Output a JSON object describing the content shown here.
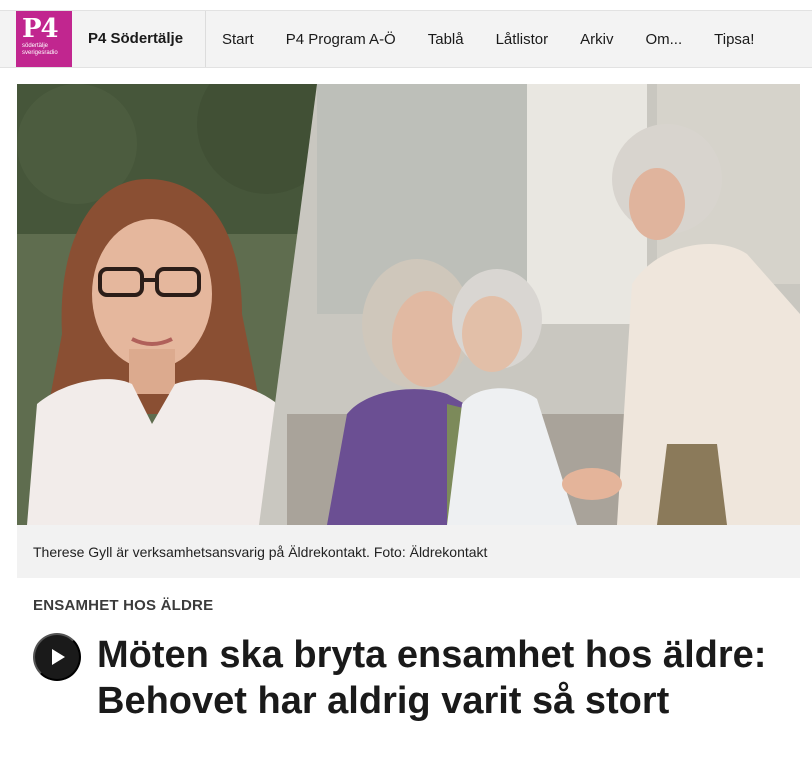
{
  "header": {
    "logo_text": "P4",
    "logo_subtext": "södertälje sverigesradio",
    "station_name": "P4 Södertälje",
    "nav": [
      "Start",
      "P4 Program A-Ö",
      "Tablå",
      "Låtlistor",
      "Arkiv",
      "Om...",
      "Tipsa!"
    ]
  },
  "hero": {
    "caption": "Therese Gyll är verksamhetsansvarig på Äldrekontakt. Foto: Äldrekontakt"
  },
  "article": {
    "kicker": "ENSAMHET HOS ÄLDRE",
    "headline": "Möten ska bryta ensamhet hos äldre: Behovet har aldrig varit så stort",
    "play_icon": "play-icon"
  },
  "colors": {
    "brand": "#c1268f",
    "nav_bg": "#f3f3f3",
    "caption_bg": "#f2f2f2",
    "text": "#1a1a1a"
  }
}
